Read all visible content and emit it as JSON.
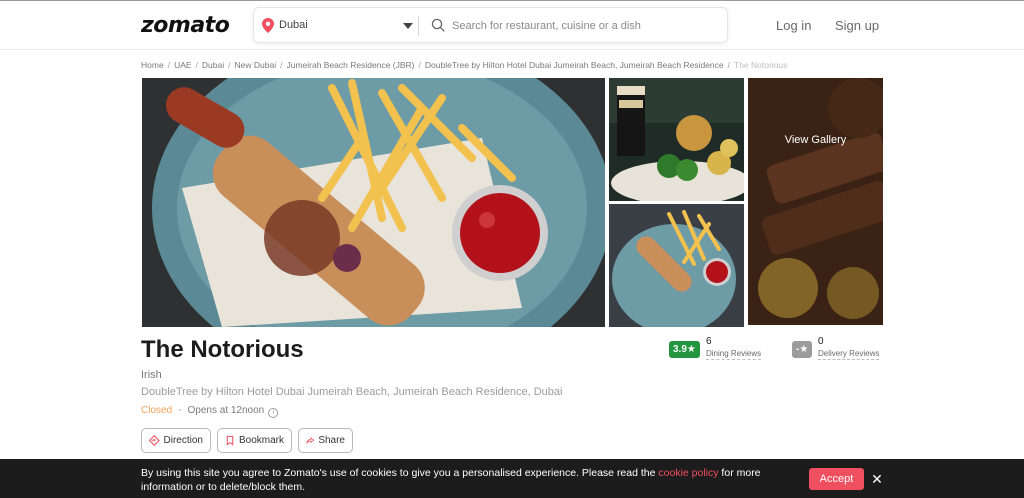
{
  "header": {
    "logo": "zomato",
    "location": "Dubai",
    "search_placeholder": "Search for restaurant, cuisine or a dish",
    "login": "Log in",
    "signup": "Sign up"
  },
  "breadcrumb": {
    "items": [
      "Home",
      "UAE",
      "Dubai",
      "New Dubai",
      "Jumeirah Beach Residence (JBR)",
      "DoubleTree by Hilton Hotel Dubai Jumeirah Beach, Jumeirah Beach Residence",
      "The Notorious"
    ],
    "separator": "/"
  },
  "gallery": {
    "view_gallery": "View Gallery"
  },
  "restaurant": {
    "name": "The Notorious",
    "cuisine": "Irish",
    "address": "DoubleTree by Hilton Hotel Dubai Jumeirah Beach, Jumeirah Beach Residence, Dubai",
    "status": "Closed",
    "status_separator": "-",
    "opens": "Opens at 12noon"
  },
  "ratings": {
    "dining": {
      "score": "3.9",
      "star": "★",
      "count": "6",
      "label": "Dining Reviews",
      "color": "#24963f"
    },
    "delivery": {
      "score": "-",
      "star": "★",
      "count": "0",
      "label": "Delivery Reviews",
      "color": "#9c9c9c"
    }
  },
  "actions": {
    "direction": "Direction",
    "bookmark": "Bookmark",
    "share": "Share"
  },
  "cookie": {
    "text_before": "By using this site you agree to Zomato's use of cookies to give you a personalised experience. Please read the ",
    "link": "cookie policy",
    "text_after": " for more information or to delete/block them.",
    "accept": "Accept",
    "close": "✕"
  },
  "colors": {
    "brand_red": "#ef4f5f",
    "rating_green": "#24963f",
    "closed_orange": "#f4a259"
  }
}
